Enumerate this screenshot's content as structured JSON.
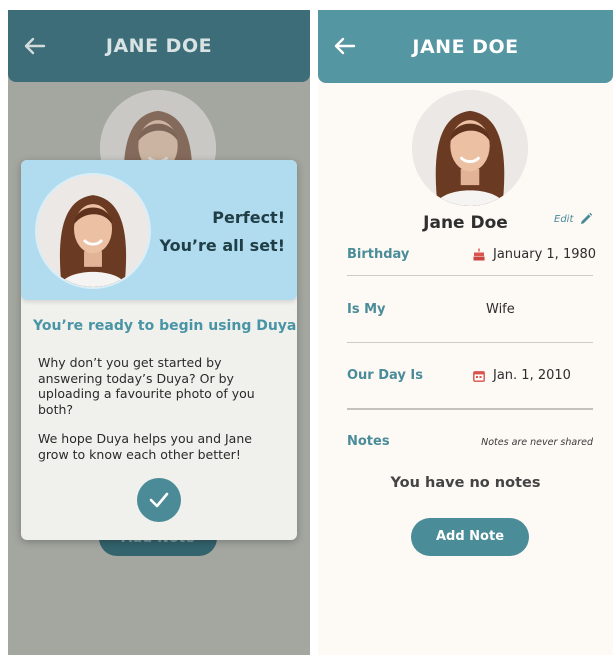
{
  "colors": {
    "header_dim": "#3c6d78",
    "header": "#5596a3",
    "accent": "#4a8c99",
    "overlay": "#a4a6a0",
    "modal_top": "#b1dcef",
    "background": "#fdf9f4"
  },
  "left": {
    "header": {
      "title": "JANE DOE",
      "back_icon": "arrow-left-icon"
    },
    "background_button_label": "Add Note",
    "modal": {
      "message_line1": "Perfect!",
      "message_line2": "You’re all set!",
      "heading": "You’re ready to begin using Duya",
      "paragraph1": "Why don’t you get started by answering today’s Duya? Or by uploading a favourite photo of you both?",
      "paragraph2": "We hope Duya helps you and Jane grow to know each other better!",
      "confirm_icon": "check-icon"
    }
  },
  "right": {
    "header": {
      "title": "JANE DOE",
      "back_icon": "arrow-left-icon"
    },
    "profile": {
      "name": "Jane Doe",
      "edit_label": "Edit",
      "edit_icon": "pencil-icon"
    },
    "fields": {
      "birthday": {
        "label": "Birthday",
        "value": "January 1, 1980",
        "icon": "cake-icon"
      },
      "is_my": {
        "label": "Is My",
        "value": "Wife"
      },
      "our_day": {
        "label": "Our Day Is",
        "value": "Jan. 1, 2010",
        "icon": "calendar-icon"
      }
    },
    "notes": {
      "label": "Notes",
      "info": "Notes are never shared",
      "empty_text": "You have no notes",
      "add_button": "Add Note"
    }
  }
}
